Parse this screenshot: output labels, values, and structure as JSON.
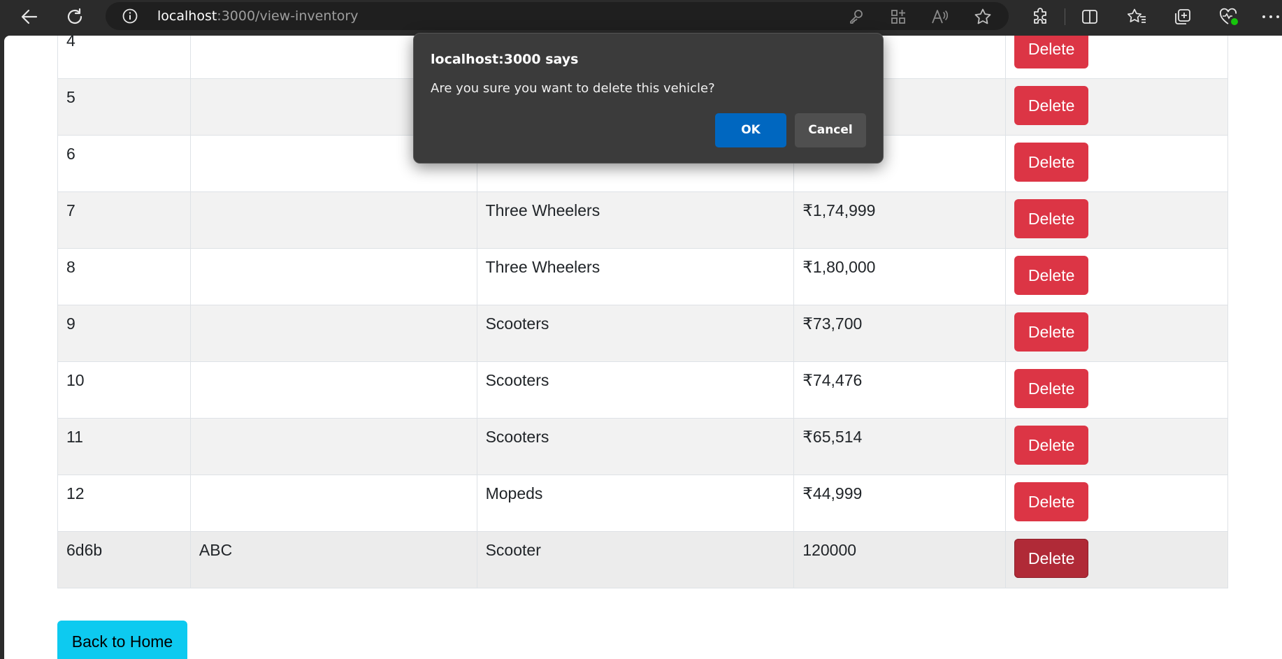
{
  "browser": {
    "url_host": "localhost",
    "url_rest": ":3000/view-inventory",
    "icons": [
      "back-arrow-icon",
      "refresh-icon",
      "site-info-icon",
      "key-icon",
      "app-grid-icon",
      "read-aloud-icon",
      "star-icon",
      "extensions-icon",
      "split-screen-icon",
      "favorites-icon",
      "collections-icon",
      "health-icon",
      "more-icon"
    ]
  },
  "table": {
    "rows": [
      {
        "id": "4",
        "name": "",
        "category": "",
        "price": ""
      },
      {
        "id": "5",
        "name": "",
        "category": "",
        "price": ""
      },
      {
        "id": "6",
        "name": "",
        "category": "",
        "price": ""
      },
      {
        "id": "7",
        "name": "",
        "category": "Three Wheelers",
        "price": "₹1,74,999"
      },
      {
        "id": "8",
        "name": "",
        "category": "Three Wheelers",
        "price": "₹1,80,000"
      },
      {
        "id": "9",
        "name": "",
        "category": "Scooters",
        "price": "₹73,700"
      },
      {
        "id": "10",
        "name": "",
        "category": "Scooters",
        "price": "₹74,476"
      },
      {
        "id": "11",
        "name": "",
        "category": "Scooters",
        "price": "₹65,514"
      },
      {
        "id": "12",
        "name": "",
        "category": "Mopeds",
        "price": "₹44,999"
      },
      {
        "id": "6d6b",
        "name": "ABC",
        "category": "Scooter",
        "price": "120000"
      }
    ],
    "delete_label": "Delete"
  },
  "back_button": {
    "label": "Back to Home",
    "color": "#0dcaf0"
  },
  "dialog": {
    "title": "localhost:3000 says",
    "message": "Are you sure you want to delete this vehicle?",
    "ok_label": "OK",
    "cancel_label": "Cancel"
  },
  "colors": {
    "delete": "#dc3545",
    "ok": "#0067c0"
  }
}
